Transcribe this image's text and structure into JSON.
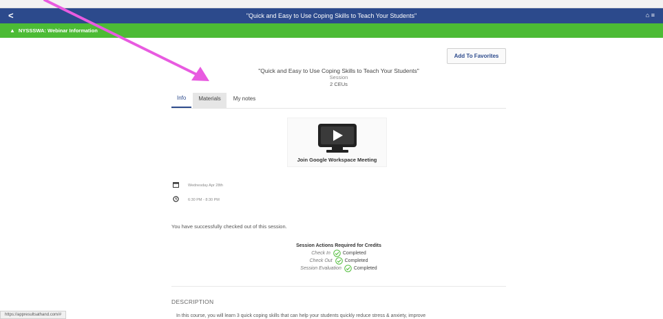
{
  "topbar": {
    "back_glyph": "<",
    "title": "\"Quick and Easy to Use Coping Skills to Teach Your Students\"",
    "home_glyph": "⌂ ≡"
  },
  "banner": {
    "warn_glyph": "▲",
    "text": "NYSSSWA: Webinar Information"
  },
  "favorites_button": "Add To Favorites",
  "session": {
    "title": "\"Quick and Easy to Use Coping Skills to Teach Your Students\"",
    "type": "Session",
    "credits": "2 CEUs"
  },
  "tabs": [
    {
      "label": "Info"
    },
    {
      "label": "Materials"
    },
    {
      "label": "My notes"
    }
  ],
  "meeting": {
    "label": "Join Google Workspace Meeting",
    "icon": "play-monitor-icon"
  },
  "meta": {
    "date": "Wednesday Apr 28th",
    "time": "6:30 PM - 8:30 PM"
  },
  "checkout_message": "You have successfully checked out of this session.",
  "actions": {
    "title": "Session Actions Required for Credits",
    "items": [
      {
        "label": "Check In",
        "status": "Completed"
      },
      {
        "label": "Check Out",
        "status": "Completed"
      },
      {
        "label": "Session Evaluation",
        "status": "Completed"
      }
    ]
  },
  "description": {
    "heading": "DESCRIPTION",
    "text": "In this course, you will learn 3 quick coping skills that can help your students quickly reduce stress & anxiety, improve"
  },
  "status_url": "https://appresultsathand.com/#",
  "colors": {
    "topbar": "#2c4a8c",
    "banner": "#4cbb35",
    "success": "#4cbb35",
    "annotation_arrow": "#e85be0"
  }
}
